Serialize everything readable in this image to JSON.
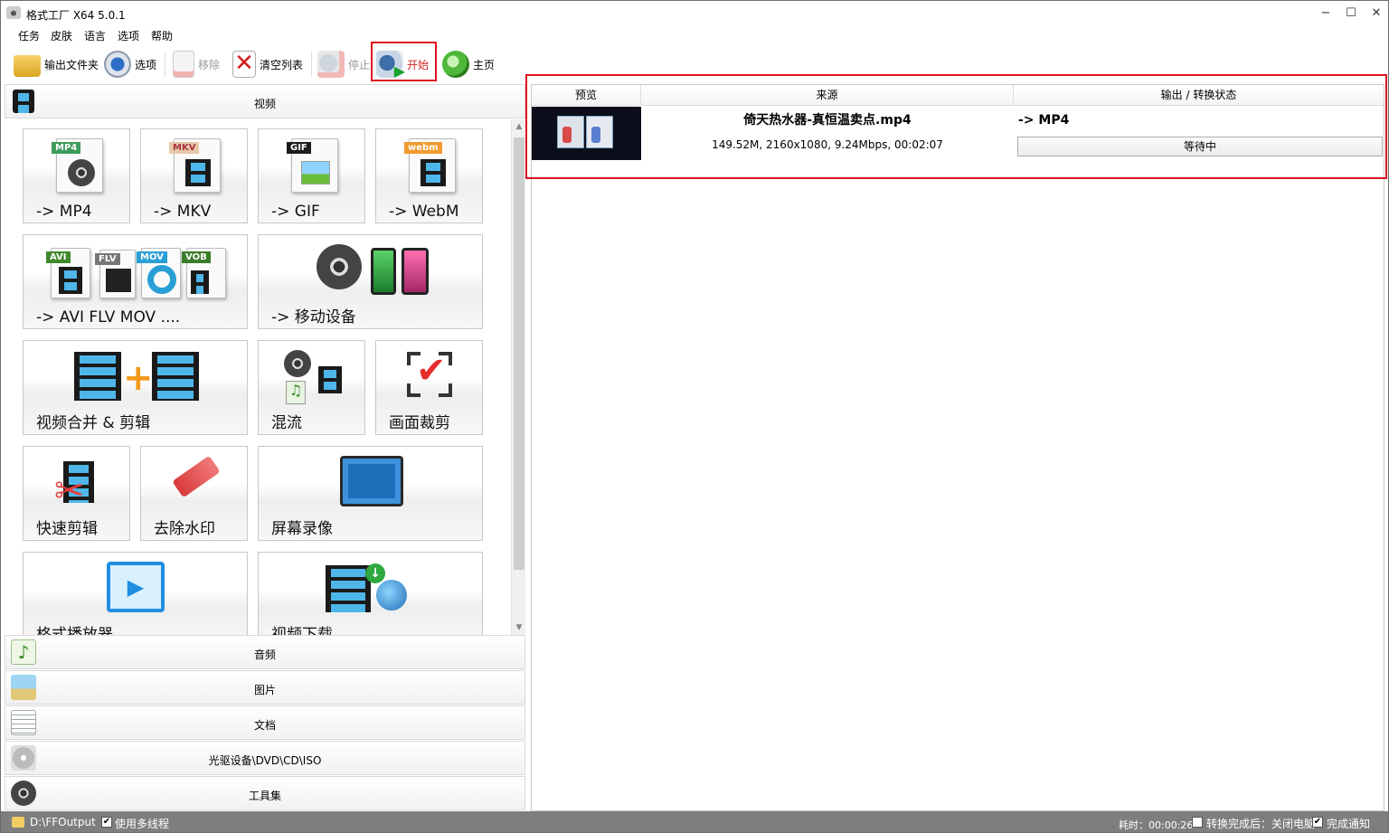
{
  "window": {
    "title": "格式工厂 X64 5.0.1",
    "minimize": "−",
    "maximize": "☐",
    "close": "✕"
  },
  "menu": [
    "任务",
    "皮肤",
    "语言",
    "选项",
    "帮助"
  ],
  "toolbar": {
    "output_folder": "输出文件夹",
    "options": "选项",
    "remove": "移除",
    "clear_list": "清空列表",
    "stop": "停止",
    "start": "开始",
    "home": "主页"
  },
  "categories": {
    "video": "视频",
    "audio": "音频",
    "image": "图片",
    "document": "文档",
    "disc": "光驱设备\\DVD\\CD\\ISO",
    "tools": "工具集"
  },
  "tiles": {
    "mp4": "-> MP4",
    "mkv": "-> MKV",
    "gif": "-> GIF",
    "webm": "-> WebM",
    "avi_flv_mov": "-> AVI FLV MOV ....",
    "mobile": "-> 移动设备",
    "merge": "视频合并 & 剪辑",
    "mux": "混流",
    "crop": "画面裁剪",
    "quick_cut": "快速剪辑",
    "watermark": "去除水印",
    "screen_record": "屏幕录像",
    "player": "格式播放器",
    "download": "视频下载"
  },
  "tile_tags": {
    "mp4": "MP4",
    "mkv": "MKV",
    "gif": "GIF",
    "webm": "webm",
    "avi": "AVI",
    "flv": "FLV",
    "mov": "MOV",
    "vob": "VOB"
  },
  "task_list": {
    "columns": {
      "preview": "预览",
      "source": "来源",
      "output": "输出 / 转换状态"
    },
    "tasks": [
      {
        "name": "倚天热水器-真恒温卖点.mp4",
        "info": "149.52M, 2160x1080, 9.24Mbps, 00:02:07",
        "output": "-> MP4",
        "status": "等待中"
      }
    ]
  },
  "statusbar": {
    "output_path": "D:\\FFOutput",
    "multithread": "使用多线程",
    "multithread_checked": true,
    "elapsed": "耗时：00:00:26",
    "after_done": "转换完成后：关闭电脑",
    "after_done_checked": false,
    "notify": "完成通知",
    "notify_checked": true
  },
  "colors": {
    "highlight": "#e0141e",
    "statusbar_bg": "#7e7e7e"
  }
}
